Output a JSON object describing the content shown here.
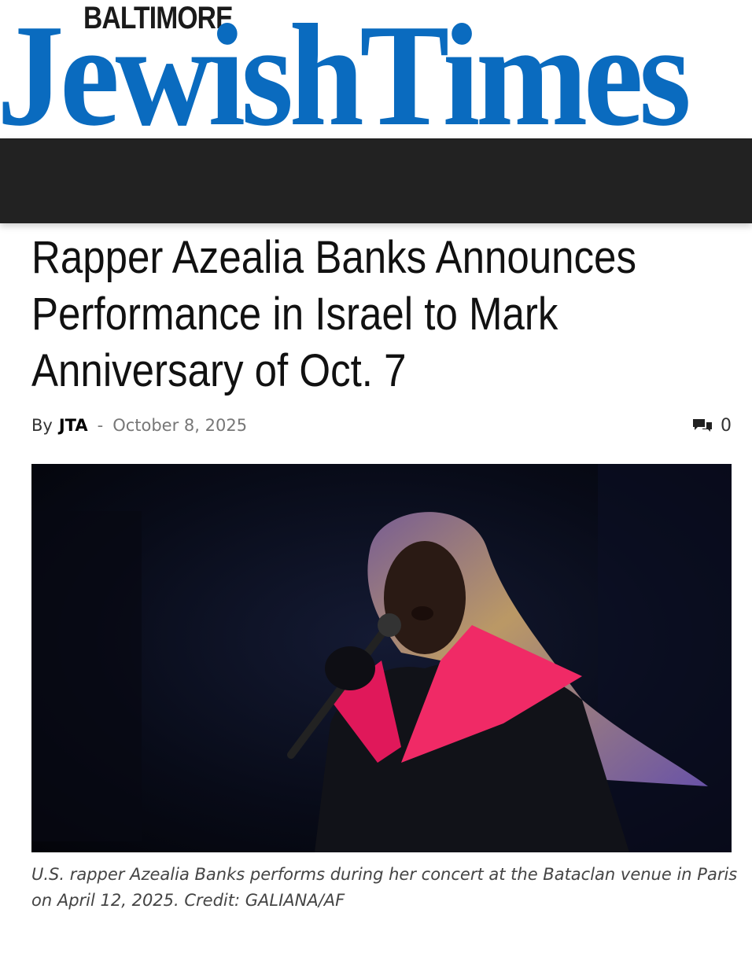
{
  "masthead": {
    "city": "BALTIMORE",
    "title": "JewishTimes",
    "brand_color": "#0a6bbf"
  },
  "navbar": {
    "color": "#222222"
  },
  "article": {
    "headline": "Rapper Azealia Banks Announces Performance in Israel to Mark Anniversary of Oct. 7",
    "byline": {
      "by": "By",
      "author": "JTA",
      "separator": "-",
      "date": "October 8, 2025"
    },
    "comments": {
      "icon": "comment-bubbles-icon",
      "count": "0"
    },
    "photo": {
      "subject": "rapper-performing-on-stage"
    },
    "caption": "U.S. rapper Azealia Banks performs during her concert at the Bataclan venue in Paris on April 12, 2025. Credit: GALIANA/AF"
  }
}
